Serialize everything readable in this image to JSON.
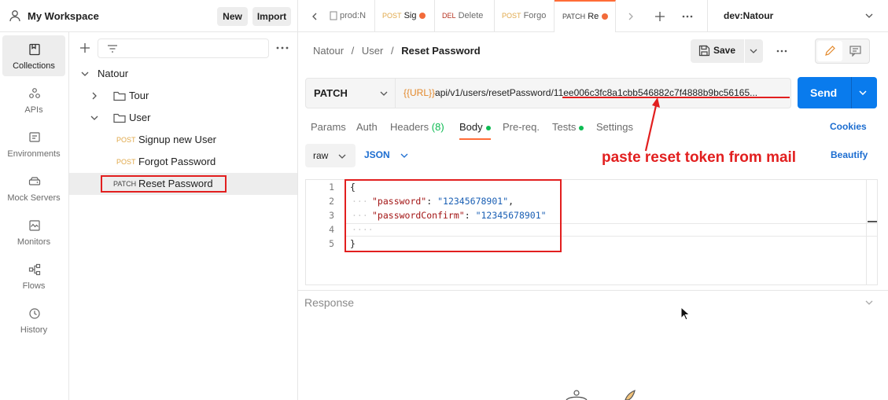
{
  "workspace": {
    "title": "My Workspace",
    "new_label": "New",
    "import_label": "Import"
  },
  "rail": [
    {
      "label": "Collections",
      "icon": "collections-icon",
      "active": true
    },
    {
      "label": "APIs",
      "icon": "apis-icon"
    },
    {
      "label": "Environments",
      "icon": "environments-icon"
    },
    {
      "label": "Mock Servers",
      "icon": "mock-servers-icon"
    },
    {
      "label": "Monitors",
      "icon": "monitors-icon"
    },
    {
      "label": "Flows",
      "icon": "flows-icon"
    },
    {
      "label": "History",
      "icon": "history-icon"
    }
  ],
  "tree": {
    "collection": "Natour",
    "folders": [
      "Tour",
      "User"
    ],
    "requests": [
      {
        "method": "POST",
        "name": "Signup new User"
      },
      {
        "method": "POST",
        "name": "Forgot Password"
      },
      {
        "method": "PATCH",
        "name": "Reset Password"
      }
    ]
  },
  "tabs": [
    {
      "label": "prod:N"
    },
    {
      "method": "POST",
      "label": "Sig"
    },
    {
      "method": "DEL",
      "label": "Delete"
    },
    {
      "method": "POST",
      "label": "Forgo"
    },
    {
      "method": "PATCH",
      "label": "Re"
    }
  ],
  "environment": "dev:Natour",
  "breadcrumb": {
    "part1": "Natour",
    "part2": "User",
    "current": "Reset Password"
  },
  "save_label": "Save",
  "request": {
    "method": "PATCH",
    "url_var": "{{URL}}",
    "url_path": "api/v1/users/resetPassword/",
    "url_token": "11ee006c3fc8a1cbb546882c7f4888b9bc56165...",
    "send_label": "Send"
  },
  "subtabs": {
    "params": "Params",
    "auth": "Auth",
    "headers": "Headers",
    "headers_count": "(8)",
    "body": "Body",
    "prereq": "Pre-req.",
    "tests": "Tests",
    "settings": "Settings",
    "cookies": "Cookies"
  },
  "body": {
    "mode": "raw",
    "format": "JSON",
    "beautify": "Beautify"
  },
  "code": {
    "lines": [
      "1",
      "2",
      "3",
      "4",
      "5"
    ],
    "open": "{",
    "close": "}",
    "k1": "\"password\"",
    "v1": "\"12345678901\"",
    "k2": "\"passwordConfirm\"",
    "v2": "\"12345678901\""
  },
  "annotation": "paste reset token from mail",
  "response_label": "Response",
  "colors": {
    "accent": "#ff6c37",
    "send": "#097bed",
    "annotation": "#e21f1f"
  }
}
